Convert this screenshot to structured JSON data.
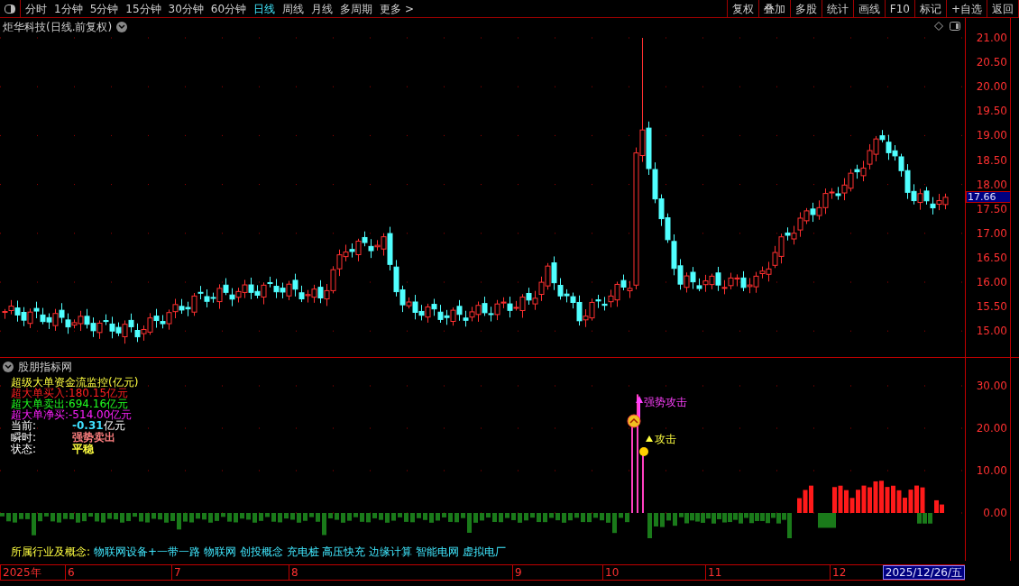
{
  "toolbar": {
    "periods": [
      {
        "label": "分时",
        "selected": false
      },
      {
        "label": "1分钟",
        "selected": false
      },
      {
        "label": "5分钟",
        "selected": false
      },
      {
        "label": "15分钟",
        "selected": false
      },
      {
        "label": "30分钟",
        "selected": false
      },
      {
        "label": "60分钟",
        "selected": false
      },
      {
        "label": "日线",
        "selected": true
      },
      {
        "label": "周线",
        "selected": false
      },
      {
        "label": "月线",
        "selected": false
      },
      {
        "label": "多周期",
        "selected": false
      },
      {
        "label": "更多 >",
        "selected": false
      }
    ],
    "actions": [
      "复权",
      "叠加",
      "多股",
      "统计",
      "画线",
      "F10",
      "标记",
      "+自选",
      "返回"
    ]
  },
  "price_panel": {
    "title": "炬华科技(日线.前复权)",
    "yticks": [
      "21.00",
      "20.50",
      "20.00",
      "19.50",
      "19.00",
      "18.50",
      "18.00",
      "17.50",
      "17.00",
      "16.50",
      "16.00",
      "15.50",
      "15.00"
    ],
    "current_price": "17.66"
  },
  "indicator_panel": {
    "title": "股朋指标网",
    "legend_title": "超级大单资金流监控(亿元)",
    "legend": [
      {
        "label": "超大单买入:180.15亿元",
        "color": "#ff2020"
      },
      {
        "label": "超大单卖出:694.16亿元",
        "color": "#20ff20"
      },
      {
        "label": "超大单净买:-514.00亿元",
        "color": "#ff20ff"
      }
    ],
    "status": [
      {
        "label": "当前:",
        "value": "-0.31",
        "unit": "亿元",
        "color": "#40e0ff"
      },
      {
        "label": "瞬时:",
        "value": "强势卖出",
        "color": "#ff8080"
      },
      {
        "label": "状态:",
        "value": "平稳",
        "color": "#ffff40"
      }
    ],
    "annotations": [
      {
        "kind": "strong",
        "text": "强势攻击"
      },
      {
        "kind": "attack",
        "text": "攻击"
      }
    ],
    "yticks": [
      "30.00",
      "20.00",
      "10.00",
      "0.00"
    ]
  },
  "concepts": {
    "label": "所属行业及概念:",
    "items": "物联网设备+一带一路 物联网 创投概念 充电桩 高压快充 边缘计算 智能电网 虚拟电厂"
  },
  "date_axis": {
    "labels": [
      "2025年",
      "6",
      "7",
      "8",
      "9",
      "10",
      "11",
      "12"
    ],
    "current_date": "2025/12/26/五"
  }
}
